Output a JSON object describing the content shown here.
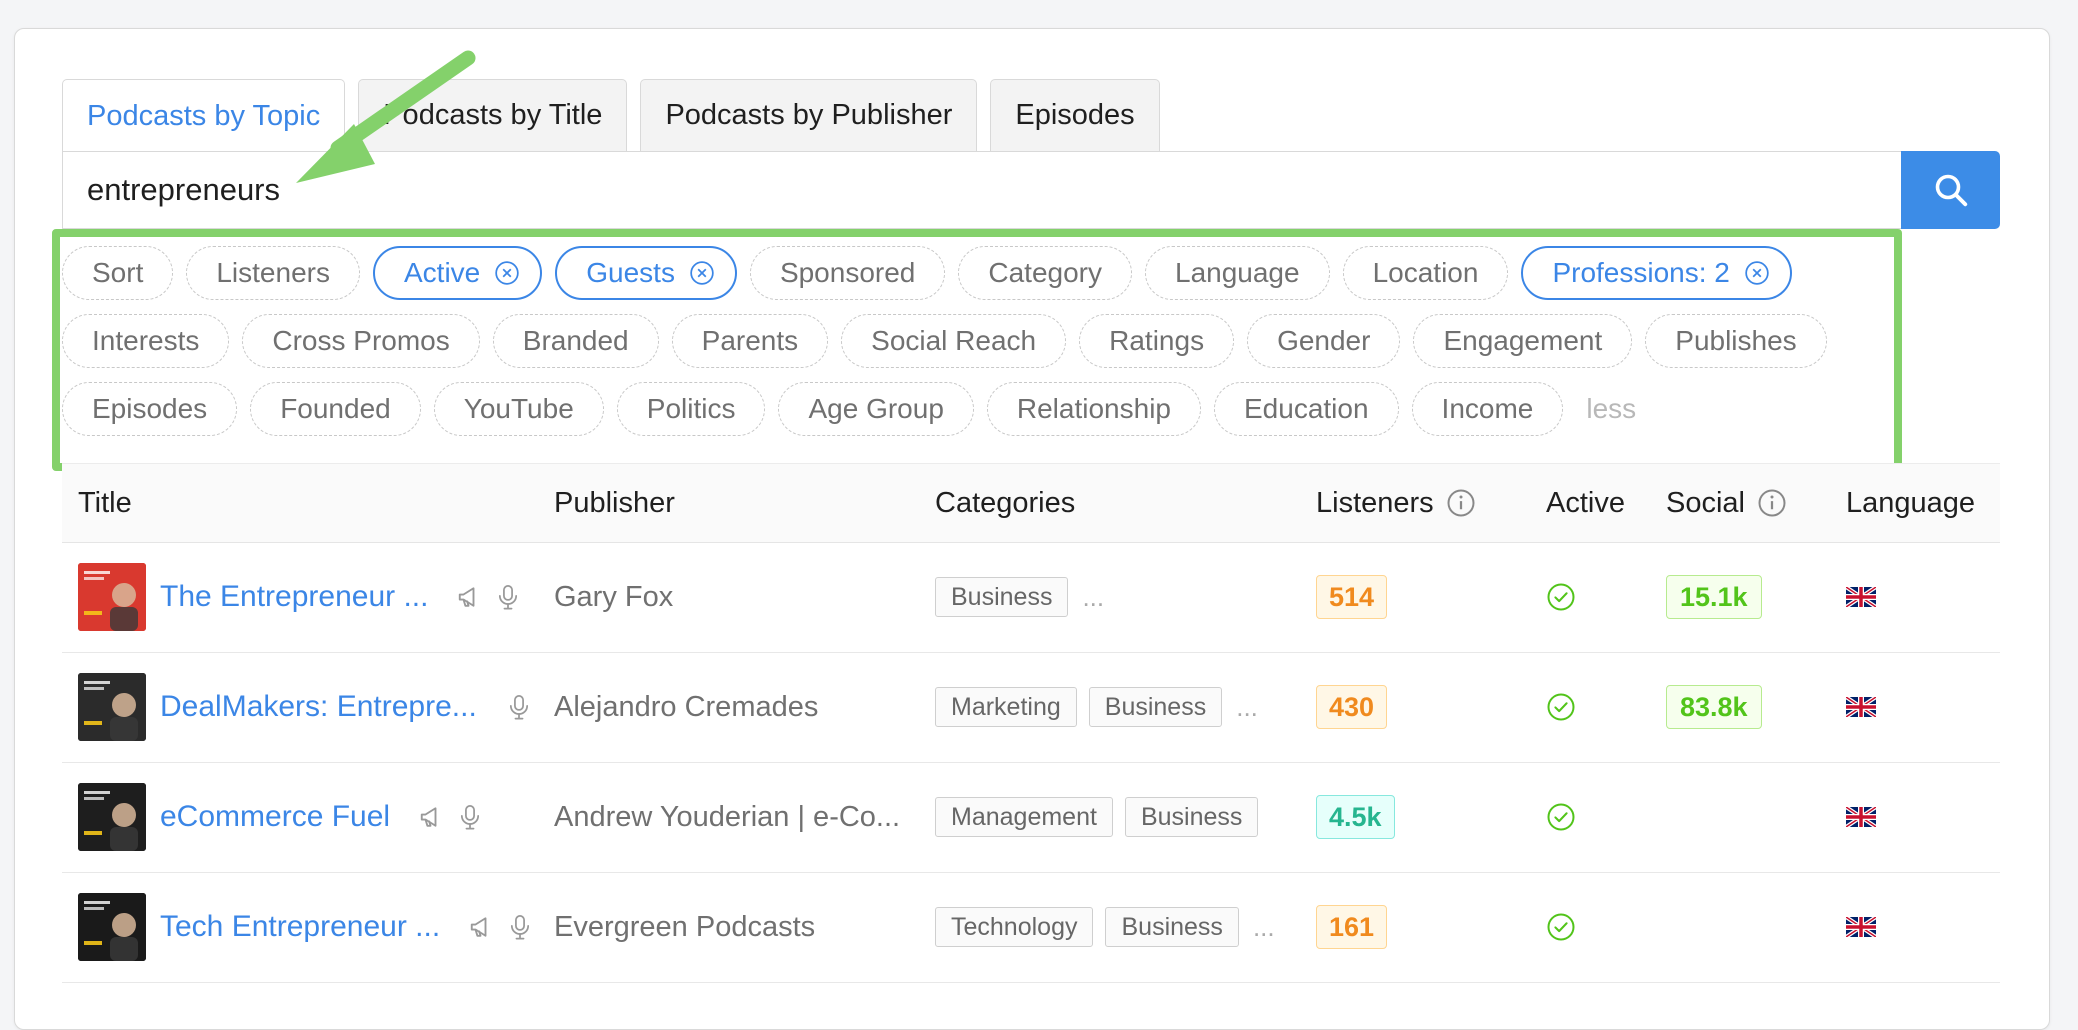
{
  "tabs": [
    {
      "label": "Podcasts by Topic",
      "active": true
    },
    {
      "label": "Podcasts by Title",
      "active": false
    },
    {
      "label": "Podcasts by Publisher",
      "active": false
    },
    {
      "label": "Episodes",
      "active": false
    }
  ],
  "search": {
    "value": "entrepreneurs",
    "button_icon": "search-icon"
  },
  "filters": {
    "rows": [
      [
        {
          "label": "Sort",
          "active": false
        },
        {
          "label": "Listeners",
          "active": false
        },
        {
          "label": "Active",
          "active": true
        },
        {
          "label": "Guests",
          "active": true
        },
        {
          "label": "Sponsored",
          "active": false
        },
        {
          "label": "Category",
          "active": false
        },
        {
          "label": "Language",
          "active": false
        },
        {
          "label": "Location",
          "active": false
        },
        {
          "label": "Professions: 2",
          "active": true
        }
      ],
      [
        {
          "label": "Interests",
          "active": false
        },
        {
          "label": "Cross Promos",
          "active": false
        },
        {
          "label": "Branded",
          "active": false
        },
        {
          "label": "Parents",
          "active": false
        },
        {
          "label": "Social Reach",
          "active": false
        },
        {
          "label": "Ratings",
          "active": false
        },
        {
          "label": "Gender",
          "active": false
        },
        {
          "label": "Engagement",
          "active": false
        },
        {
          "label": "Publishes",
          "active": false
        }
      ],
      [
        {
          "label": "Episodes",
          "active": false
        },
        {
          "label": "Founded",
          "active": false
        },
        {
          "label": "YouTube",
          "active": false
        },
        {
          "label": "Politics",
          "active": false
        },
        {
          "label": "Age Group",
          "active": false
        },
        {
          "label": "Relationship",
          "active": false
        },
        {
          "label": "Education",
          "active": false
        },
        {
          "label": "Income",
          "active": false
        }
      ]
    ],
    "less_label": "less",
    "highlight_color": "#84d16b"
  },
  "table": {
    "headers": {
      "title": "Title",
      "publisher": "Publisher",
      "categories": "Categories",
      "listeners": "Listeners",
      "active": "Active",
      "social": "Social",
      "language": "Language"
    },
    "rows": [
      {
        "thumb_bg": "#d9392f",
        "thumb_text": "THE ENTREPRENEUR EXPERIMENT",
        "title": "The Entrepreneur ...",
        "sponsored_icon": true,
        "guests_icon": true,
        "publisher": "Gary Fox",
        "categories": [
          "Business"
        ],
        "more_categories": true,
        "listeners": "514",
        "listeners_color": "orange",
        "active": true,
        "social": "15.1k",
        "language_flag": "uk-flag-icon"
      },
      {
        "thumb_bg": "#2b2b2b",
        "thumb_text": "DEALMAKERS",
        "title": "DealMakers: Entrepre...",
        "sponsored_icon": false,
        "guests_icon": true,
        "publisher": "Alejandro Cremades",
        "categories": [
          "Marketing",
          "Business"
        ],
        "more_categories": true,
        "listeners": "430",
        "listeners_color": "orange",
        "active": true,
        "social": "83.8k",
        "language_flag": "uk-flag-icon"
      },
      {
        "thumb_bg": "#1e1e1e",
        "thumb_text": "eCommerceFuel",
        "title": "eCommerce Fuel",
        "sponsored_icon": true,
        "guests_icon": true,
        "publisher": "Andrew Youderian | e-Co...",
        "categories": [
          "Management",
          "Business"
        ],
        "more_categories": false,
        "listeners": "4.5k",
        "listeners_color": "teal",
        "active": true,
        "social": "",
        "language_flag": "uk-flag-icon"
      },
      {
        "thumb_bg": "#1a1a1a",
        "thumb_text": "Tech entrepreneur",
        "title": "Tech Entrepreneur ...",
        "sponsored_icon": true,
        "guests_icon": true,
        "publisher": "Evergreen Podcasts",
        "categories": [
          "Technology",
          "Business"
        ],
        "more_categories": true,
        "listeners": "161",
        "listeners_color": "orange",
        "active": true,
        "social": "",
        "language_flag": "uk-flag-icon"
      }
    ]
  }
}
